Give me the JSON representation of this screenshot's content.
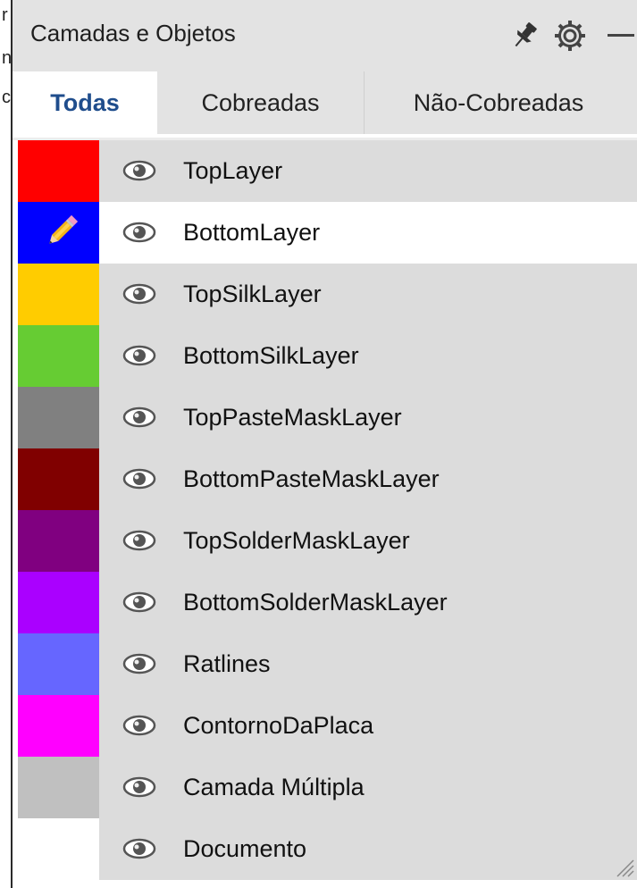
{
  "background_window": {
    "fragments": [
      "r",
      "nc",
      "c"
    ]
  },
  "panel": {
    "title": "Camadas e Objetos",
    "icons": [
      "pin-icon",
      "gear-icon",
      "minimize-icon"
    ]
  },
  "tabs": [
    {
      "label": "Todas",
      "active": true
    },
    {
      "label": "Cobreadas",
      "active": false
    },
    {
      "label": "Não-Cobreadas",
      "active": false
    }
  ],
  "layers": [
    {
      "label": "TopLayer",
      "color": "#ff0000",
      "selected": false
    },
    {
      "label": "BottomLayer",
      "color": "#0000ff",
      "selected": true,
      "editing_icon": "pencil-icon"
    },
    {
      "label": "TopSilkLayer",
      "color": "#ffcc00",
      "selected": false
    },
    {
      "label": "BottomSilkLayer",
      "color": "#66cc33",
      "selected": false
    },
    {
      "label": "TopPasteMaskLayer",
      "color": "#808080",
      "selected": false
    },
    {
      "label": "BottomPasteMaskLayer",
      "color": "#800000",
      "selected": false
    },
    {
      "label": "TopSolderMaskLayer",
      "color": "#800080",
      "selected": false
    },
    {
      "label": "BottomSolderMaskLayer",
      "color": "#aa00ff",
      "selected": false
    },
    {
      "label": "Ratlines",
      "color": "#6666ff",
      "selected": false
    },
    {
      "label": "ContornoDaPlaca",
      "color": "#ff00ff",
      "selected": false
    },
    {
      "label": "Camada Múltipla",
      "color": "#c0c0c0",
      "selected": false
    },
    {
      "label": "Documento",
      "color": "#ffffff",
      "selected": false
    }
  ]
}
